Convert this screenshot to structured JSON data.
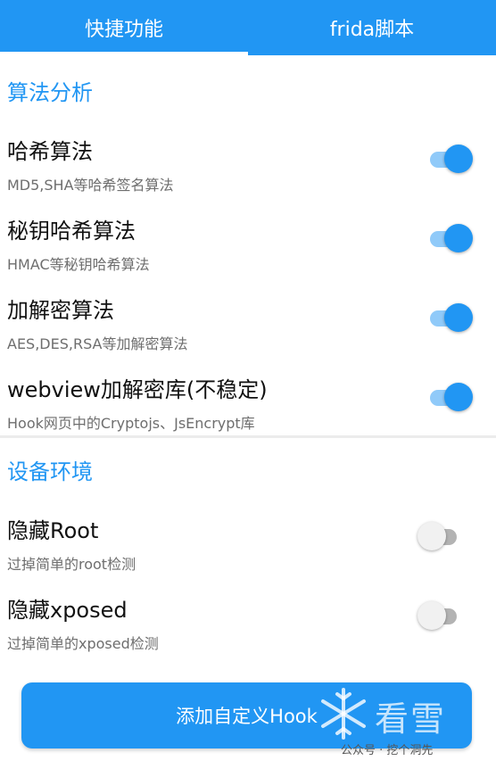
{
  "tabs": [
    {
      "label": "快捷功能",
      "active": true
    },
    {
      "label": "frida脚本",
      "active": false
    }
  ],
  "sections": {
    "algo": {
      "title": "算法分析",
      "items": [
        {
          "title": "哈希算法",
          "desc": "MD5,SHA等哈希签名算法",
          "enabled": true
        },
        {
          "title": "秘钥哈希算法",
          "desc": "HMAC等秘钥哈希算法",
          "enabled": true
        },
        {
          "title": "加解密算法",
          "desc": "AES,DES,RSA等加解密算法",
          "enabled": true
        },
        {
          "title": "webview加解密库(不稳定)",
          "desc": "Hook网页中的Cryptojs、JsEncrypt库",
          "enabled": true
        }
      ]
    },
    "env": {
      "title": "设备环境",
      "items": [
        {
          "title": "隐藏Root",
          "desc": "过掉简单的root检测",
          "enabled": false
        },
        {
          "title": "隐藏xposed",
          "desc": "过掉简单的xposed检测",
          "enabled": false
        }
      ]
    }
  },
  "button": {
    "label": "添加自定义Hook"
  },
  "watermark": {
    "brand": "看雪",
    "line": "公众号 · 挖个洞先"
  },
  "colors": {
    "primary": "#2196f3",
    "track_on": "#90caf9",
    "track_off": "#b3b3b3"
  }
}
